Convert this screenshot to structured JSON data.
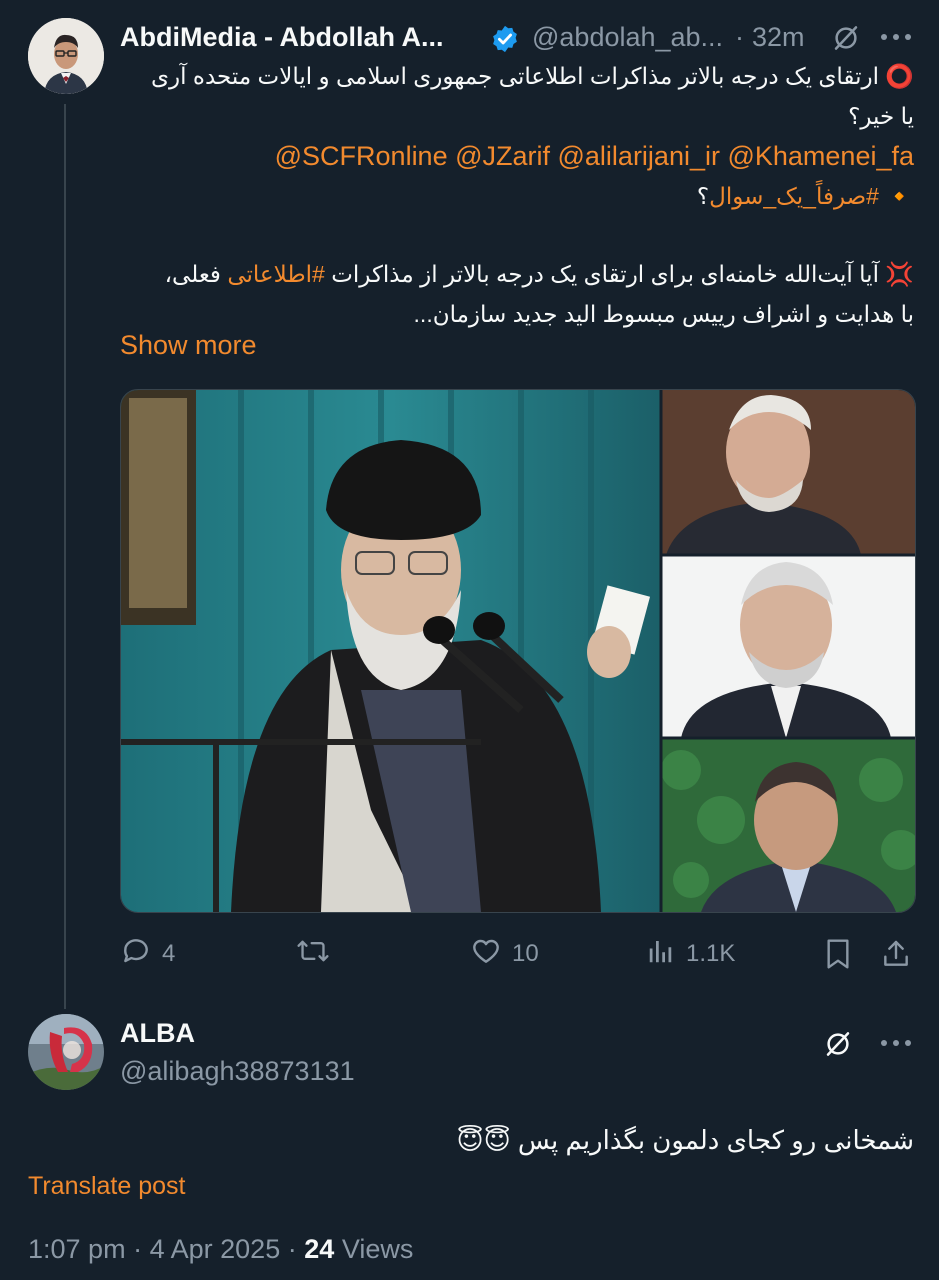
{
  "tweet": {
    "author_name": "AbdiMedia - Abdollah A...",
    "handle": "@abdolah_ab...",
    "time_sep": "·",
    "time": "32m",
    "line1": "⭕ ارتقای یک درجه بالاتر مذاکرات اطلاعاتی جمهوری اسلامی و ایالات متحده آری",
    "line2": "یا خیر؟",
    "mentions": "@SCFRonline @JZarif @alilarijani_ir @Khamenei_fa",
    "hashtag_diamond": "🔸",
    "hashtag": "#صرفاً_یک_سوال",
    "hashtag_suffix": "؟",
    "body_part1": "💢 آیا آیت‌الله خامنه‌ای برای ارتقای یک درجه بالاتر از مذاکرات",
    "body_hashtag": "#اطلاعاتی",
    "body_part2": "فعلی،",
    "line_body2": "با هدایت و اشراف رییس مبسوط الید جدید سازمان...",
    "show_more": "Show more",
    "actions": {
      "replies": "4",
      "retweets": "",
      "likes": "10",
      "views": "1.1K"
    }
  },
  "reply": {
    "author_name": "ALBA",
    "handle": "@alibagh38873131",
    "text": "شمخانی رو کجای دلمون بگذاریم پس 😇😇",
    "translate": "Translate post",
    "time": "1:07 pm",
    "sep1": "·",
    "date": "4 Apr 2025",
    "sep2": "·",
    "views_count": "24",
    "views_label": "Views"
  },
  "colors": {
    "background": "#15202b",
    "accent": "#f28a2e",
    "muted": "#8b98a5",
    "verified": "#1d9bf0"
  }
}
